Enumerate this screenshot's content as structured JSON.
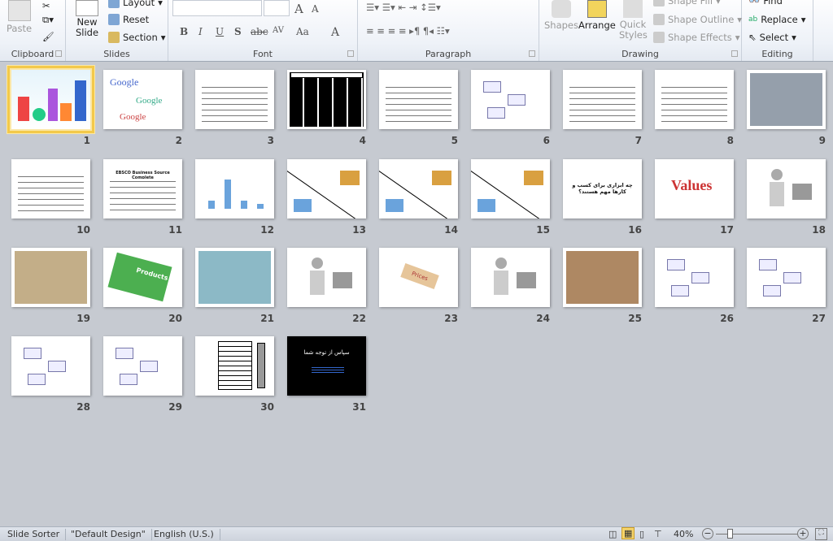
{
  "ribbon": {
    "clipboard": {
      "label": "Clipboard",
      "paste": "Paste"
    },
    "slides": {
      "label": "Slides",
      "new_slide": "New Slide",
      "layout": "Layout",
      "reset": "Reset",
      "section": "Section"
    },
    "font": {
      "label": "Font",
      "bold": "B",
      "italic": "I",
      "underline": "U",
      "shadow": "S",
      "strike": "abc",
      "spacing": "AV",
      "case": "Aa",
      "grow": "A",
      "shrink": "A",
      "color": "A"
    },
    "paragraph": {
      "label": "Paragraph"
    },
    "drawing": {
      "label": "Drawing",
      "shapes": "Shapes",
      "arrange": "Arrange",
      "quick_styles": "Quick Styles",
      "shape_fill": "Shape Fill",
      "shape_outline": "Shape Outline",
      "shape_effects": "Shape Effects"
    },
    "editing": {
      "label": "Editing",
      "find": "Find",
      "replace": "Replace",
      "select": "Select"
    }
  },
  "slides": [
    {
      "n": "1",
      "kind": "shapes",
      "selected": true
    },
    {
      "n": "2",
      "kind": "google",
      "text": "Google"
    },
    {
      "n": "3",
      "kind": "text"
    },
    {
      "n": "4",
      "kind": "blackgrid"
    },
    {
      "n": "5",
      "kind": "text"
    },
    {
      "n": "6",
      "kind": "diagram"
    },
    {
      "n": "7",
      "kind": "text"
    },
    {
      "n": "8",
      "kind": "text"
    },
    {
      "n": "9",
      "kind": "photo",
      "color": "#7a8796"
    },
    {
      "n": "10",
      "kind": "text"
    },
    {
      "n": "11",
      "kind": "text",
      "text": "EBSCO Business Source Complete"
    },
    {
      "n": "12",
      "kind": "chart"
    },
    {
      "n": "13",
      "kind": "split"
    },
    {
      "n": "14",
      "kind": "split"
    },
    {
      "n": "15",
      "kind": "split"
    },
    {
      "n": "16",
      "kind": "title",
      "text": "چه ابزاری برای کسب و کارها مهم هستند؟"
    },
    {
      "n": "17",
      "kind": "words",
      "text": "Values"
    },
    {
      "n": "18",
      "kind": "figures"
    },
    {
      "n": "19",
      "kind": "photo",
      "color": "#b49a6a"
    },
    {
      "n": "20",
      "kind": "folder",
      "text": "Products"
    },
    {
      "n": "21",
      "kind": "photo",
      "color": "#6fa7b8"
    },
    {
      "n": "22",
      "kind": "figures"
    },
    {
      "n": "23",
      "kind": "tag",
      "text": "Prices"
    },
    {
      "n": "24",
      "kind": "figures"
    },
    {
      "n": "25",
      "kind": "photo",
      "color": "#9a6a3c"
    },
    {
      "n": "26",
      "kind": "diagram"
    },
    {
      "n": "27",
      "kind": "diagram"
    },
    {
      "n": "28",
      "kind": "diagram"
    },
    {
      "n": "29",
      "kind": "diagram"
    },
    {
      "n": "30",
      "kind": "table"
    },
    {
      "n": "31",
      "kind": "dark",
      "text": "سپاس از توجه شما"
    }
  ],
  "status": {
    "view": "Slide Sorter",
    "theme": "\"Default Design\"",
    "language": "English (U.S.)",
    "zoom": "40%",
    "zoom_level": 0.4
  },
  "colors": {
    "selection": "#f3c94a",
    "background": "#c6cad1"
  }
}
